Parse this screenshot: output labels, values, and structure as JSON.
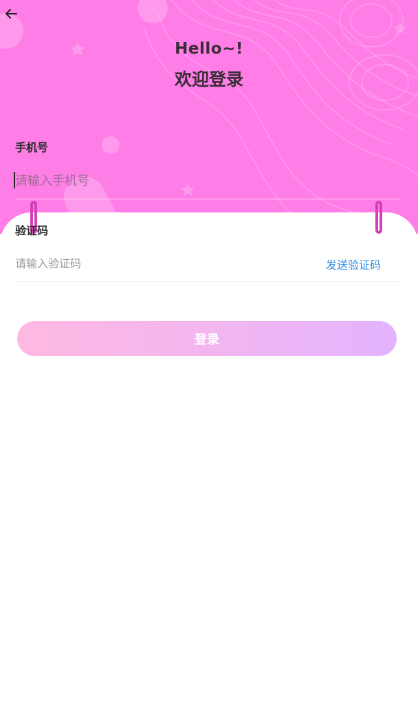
{
  "header": {
    "back_icon": "arrow-left-icon",
    "greeting": "Hello~!",
    "welcome": "欢迎登录"
  },
  "form": {
    "phone": {
      "label": "手机号",
      "placeholder": "请输入手机号",
      "value": ""
    },
    "code": {
      "label": "验证码",
      "placeholder": "请输入验证码",
      "value": "",
      "send_label": "发送验证码"
    },
    "submit_label": "登录"
  },
  "colors": {
    "hero_background": "#ff7de6",
    "title_text": "#3a2d38",
    "link": "#2b8fe6",
    "button_gradient_start": "#ffb8e2",
    "button_gradient_end": "#e4b3ff"
  }
}
